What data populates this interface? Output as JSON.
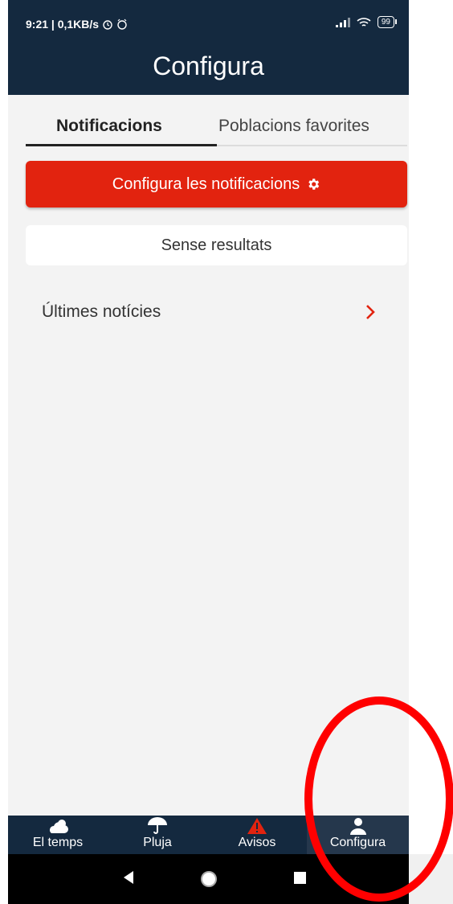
{
  "status": {
    "time_speed": "9:21 | 0,1KB/s",
    "battery": "99"
  },
  "header": {
    "title": "Configura"
  },
  "tabs": [
    {
      "label": "Notificacions",
      "active": true
    },
    {
      "label": "Poblacions favorites",
      "active": false
    }
  ],
  "configure_button": {
    "label": "Configura les notificacions",
    "icon": "gear-icon"
  },
  "empty_state": {
    "text": "Sense resultats"
  },
  "news_row": {
    "label": "Últimes notícies",
    "icon": "chevron-right-icon"
  },
  "bottom_nav": [
    {
      "label": "El temps",
      "icon": "cloud-icon",
      "active": false
    },
    {
      "label": "Pluja",
      "icon": "umbrella-icon",
      "active": false
    },
    {
      "label": "Avisos",
      "icon": "warning-icon",
      "active": false
    },
    {
      "label": "Configura",
      "icon": "user-icon",
      "active": true
    }
  ],
  "system_nav": {
    "back": "back-icon",
    "home": "home-icon",
    "recents": "recents-icon"
  },
  "colors": {
    "header_bg": "#14293f",
    "accent_red": "#e2230f",
    "page_bg": "#f3f3f3",
    "annotation_ring": "#ff0000"
  }
}
